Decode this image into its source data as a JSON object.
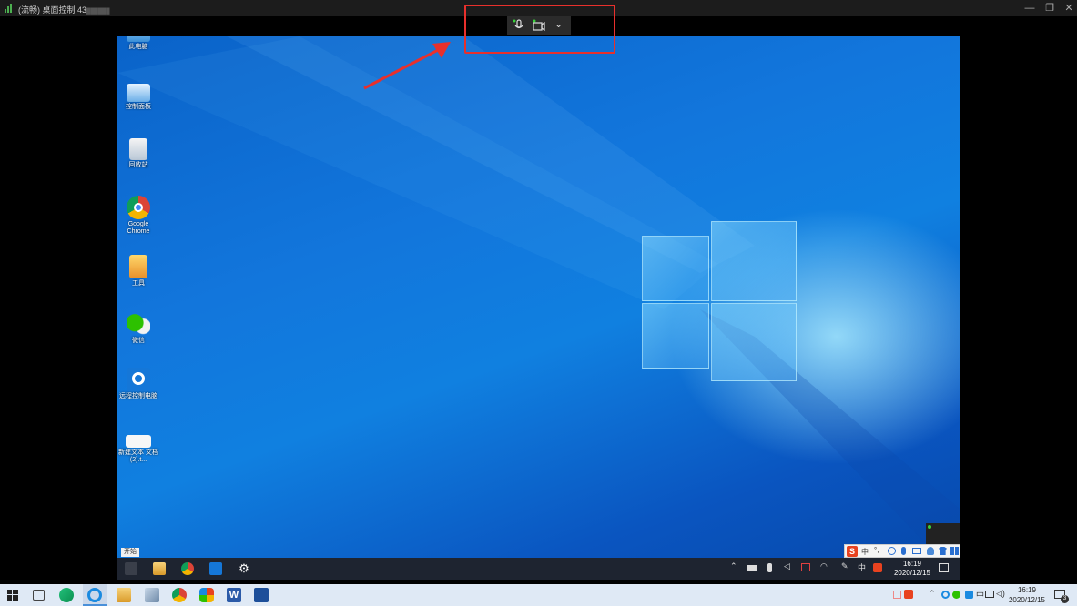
{
  "window": {
    "title": "(流畅) 桌面控制 43",
    "title_masked": "██████",
    "controls": {
      "minimize": "—",
      "restore": "❐",
      "close": "✕"
    }
  },
  "toolbar": {
    "mic_icon": "microphone-icon",
    "camera_icon": "camera-icon",
    "more": "⌄"
  },
  "desktop_icons": [
    {
      "name": "此电脑",
      "icon": "computer-icon"
    },
    {
      "name": "控制面板",
      "icon": "control-panel-icon"
    },
    {
      "name": "回收站",
      "icon": "recycle-bin-icon"
    },
    {
      "name": "Google Chrome",
      "icon": "chrome-icon"
    },
    {
      "name": "工具",
      "icon": "folder-icon"
    },
    {
      "name": "微信",
      "icon": "wechat-icon"
    },
    {
      "name": "远程控制电脑",
      "icon": "remote-app-icon"
    },
    {
      "name": "新建文本 文档(2).t...",
      "icon": "text-file-icon"
    }
  ],
  "remote_taskbar": {
    "start_label": "开始",
    "tray_lang": "中",
    "clock_time": "16:19",
    "clock_date": "2020/12/15"
  },
  "ime": {
    "lang": "中",
    "punct": "°,"
  },
  "local_taskbar": {
    "clock_time": "16:19",
    "clock_date": "2020/12/15",
    "tray_lang": "中",
    "notification_count": "3"
  },
  "colors": {
    "highlight": "#e8302c",
    "wallpaper": "#1276dc",
    "taskbar": "#dfe9f5"
  }
}
